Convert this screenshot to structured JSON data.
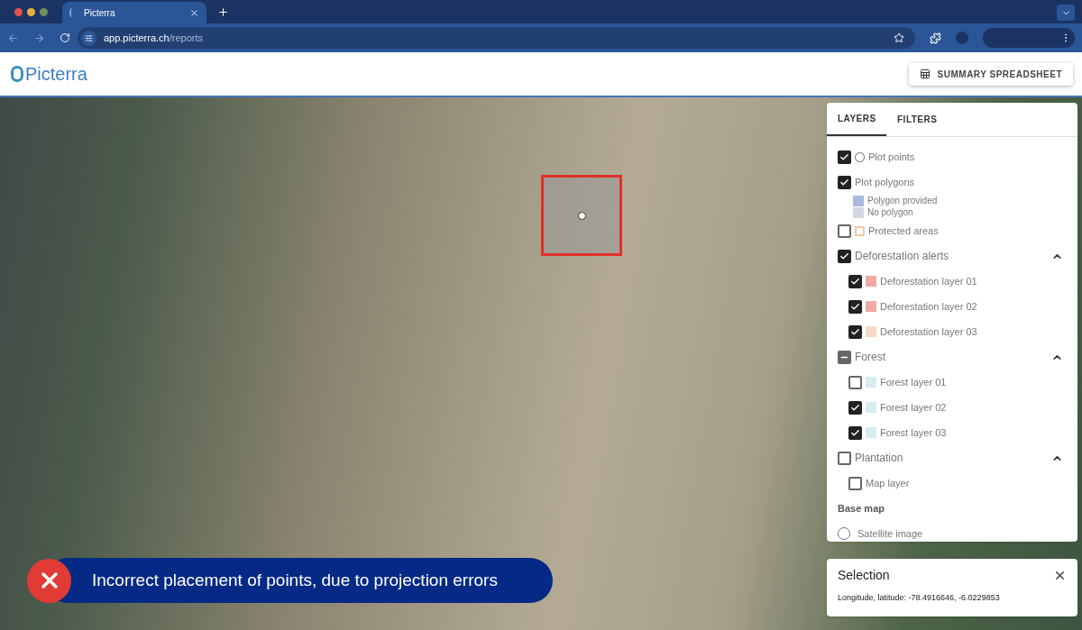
{
  "browser": {
    "tab_title": "Picterra",
    "url_host": "app.picterra.ch",
    "url_path": "/reports"
  },
  "header": {
    "logo": "Picterra",
    "button": "SUMMARY SPREADSHEET"
  },
  "tabs": [
    {
      "label": "LAYERS",
      "selected": true
    },
    {
      "label": "FILTERS",
      "selected": false
    }
  ],
  "layers": [
    {
      "kind": "check",
      "label": "Plot points",
      "checked": true,
      "ring_icon": true
    },
    {
      "kind": "check",
      "label": "Plot polygons",
      "checked": true
    },
    {
      "kind": "legend",
      "label": "Polygon provided",
      "color": "#a9b8dd"
    },
    {
      "kind": "legend",
      "label": "No polygon",
      "color": "#d3d9e2"
    },
    {
      "kind": "check",
      "label": "Protected areas",
      "checked": false,
      "outline": true,
      "color": "#f0c9a6"
    },
    {
      "kind": "group",
      "label": "Deforestation alerts",
      "checked": true,
      "indeterminate": false,
      "expanded": true,
      "children": [
        {
          "label": "Deforestation layer 01",
          "checked": true,
          "color": "#eeaaa2"
        },
        {
          "label": "Deforestation layer 02",
          "checked": true,
          "color": "#eeaaa2"
        },
        {
          "label": "Deforestation layer 03",
          "checked": true,
          "color": "#f5dcc8"
        }
      ]
    },
    {
      "kind": "group",
      "label": "Forest",
      "checked": false,
      "indeterminate": true,
      "expanded": true,
      "children": [
        {
          "label": "Forest layer 01",
          "checked": false,
          "color": "#d5ecf0"
        },
        {
          "label": "Forest layer 02",
          "checked": true,
          "color": "#d5ecf0"
        },
        {
          "label": "Forest layer 03",
          "checked": true,
          "color": "#d5ecf0"
        }
      ]
    },
    {
      "kind": "group",
      "label": "Plantation",
      "checked": false,
      "indeterminate": false,
      "expanded": true,
      "children": [
        {
          "label": "Map layer",
          "checked": false
        }
      ]
    },
    {
      "kind": "heading",
      "label": "Base map"
    },
    {
      "kind": "radio",
      "label": "Satellite image",
      "selected": false
    }
  ],
  "selection": {
    "title": "Selection",
    "text": "Longitude, latitude: -78.4916646, -6.0229853"
  },
  "banner": {
    "text": "Incorrect placement of points, due to projection errors"
  }
}
